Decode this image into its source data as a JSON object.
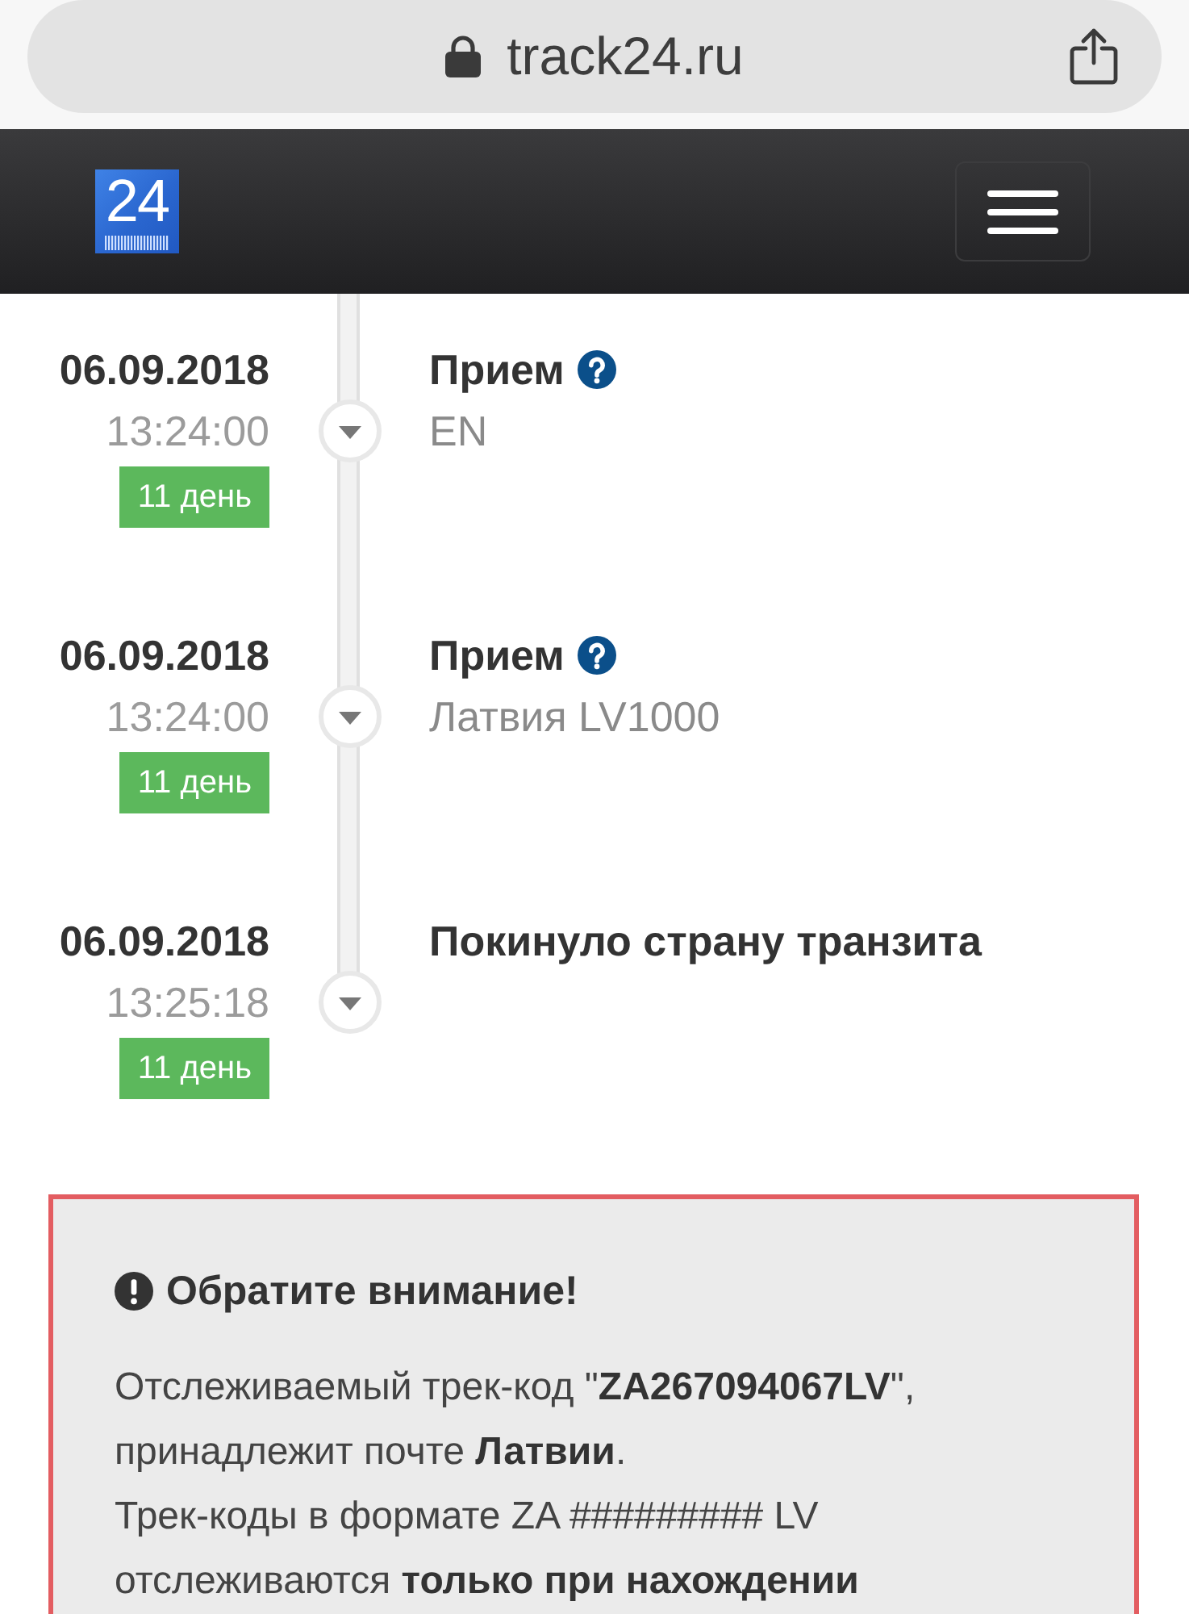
{
  "browser": {
    "url": "track24.ru"
  },
  "header": {
    "logo": "24"
  },
  "events": [
    {
      "date": "06.09.2018",
      "time": "13:24:00",
      "badge": "11 день",
      "title": "Прием",
      "help": true,
      "location": "EN"
    },
    {
      "date": "06.09.2018",
      "time": "13:24:00",
      "badge": "11 день",
      "title": "Прием",
      "help": true,
      "location": "Латвия LV1000"
    },
    {
      "date": "06.09.2018",
      "time": "13:25:18",
      "badge": "11 день",
      "title": "Покинуло страну транзита",
      "help": false
    }
  ],
  "notice": {
    "title": "Обратите внимание!",
    "paragraphs": [
      "Отслеживаемый трек-код \"**ZA267094067LV**\", принадлежит почте **Латвии**.",
      "Трек-коды в формате ZA ######### LV отслеживаются **только при нахождении**"
    ]
  }
}
